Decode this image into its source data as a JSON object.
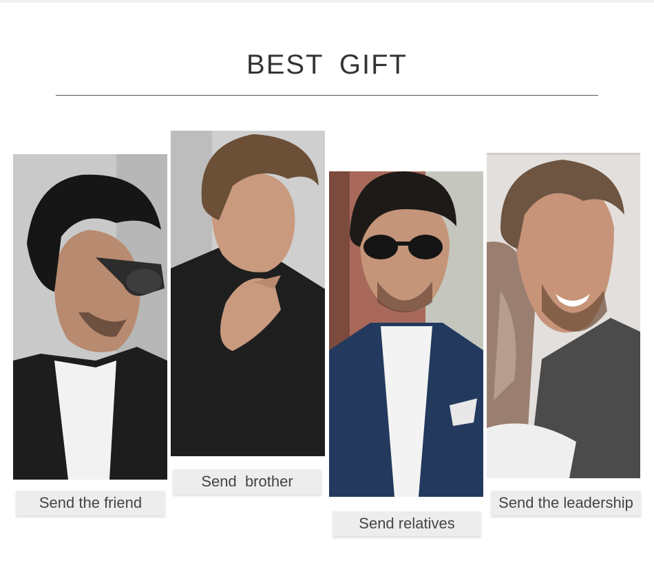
{
  "page": {
    "title": "BEST  GIFT"
  },
  "cards": [
    {
      "label": "Send the friend"
    },
    {
      "label": "Send  brother"
    },
    {
      "label": "Send relatives"
    },
    {
      "label": "Send the leadership"
    }
  ]
}
